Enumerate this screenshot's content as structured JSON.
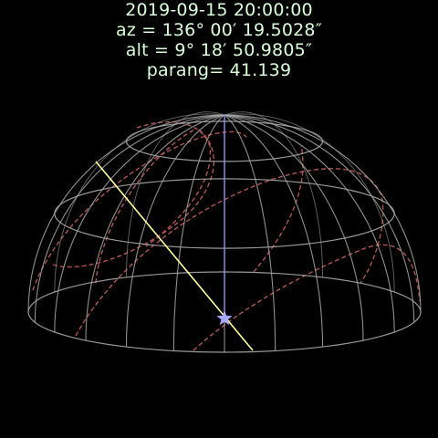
{
  "captions": {
    "time": "2019-09-15 20:00:00",
    "azimuth": "az = 136° 00′ 19.5028″",
    "altitude": "alt = 9° 18′ 50.9805″",
    "parallactic_angle": "parang= 41.139"
  },
  "colors": {
    "background": "#000000",
    "caption_text": "#d8ffd8",
    "dome_grid": "#a8a8a8",
    "equatorial_grid": "#b85858",
    "zenith_line": "#8c8cf0",
    "parallactic_line": "#ffff99",
    "star_marker": "#a8a8ff"
  },
  "marker": {
    "icon": "star-icon"
  }
}
